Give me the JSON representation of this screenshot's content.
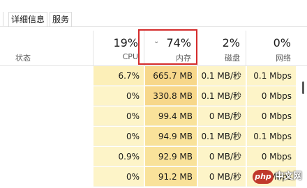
{
  "tabs": [
    "详细信息",
    "服务"
  ],
  "header": {
    "status": "状态",
    "cpu": {
      "pct": "19%",
      "name": "CPU"
    },
    "memory": {
      "pct": "74%",
      "name": "内存",
      "sort_indicator": "chevron-down-icon"
    },
    "disk": {
      "pct": "2%",
      "name": "磁盘"
    },
    "network": {
      "pct": "0%",
      "name": "网络"
    }
  },
  "rows": [
    {
      "cpu": "6.7%",
      "memory": "665.7 MB",
      "disk": "0.1 MB/秒",
      "network": "0.1 Mbps"
    },
    {
      "cpu": "0%",
      "memory": "330.8 MB",
      "disk": "0.1 MB/秒",
      "network": "0 Mbps"
    },
    {
      "cpu": "0%",
      "memory": "99.4 MB",
      "disk": "0 MB/秒",
      "network": "0 Mbps"
    },
    {
      "cpu": "0%",
      "memory": "94.9 MB",
      "disk": "0.1 MB/秒",
      "network": "0.1 Mbps"
    },
    {
      "cpu": "0.9%",
      "memory": "92.9 MB",
      "disk": "0 MB/秒",
      "network": "0 Mbps"
    },
    {
      "cpu": "0%",
      "memory": "91.2 MB",
      "disk": "0 MB/秒",
      "network": "0 Mbps"
    }
  ],
  "watermark": {
    "logo": "php",
    "text": "中文网"
  },
  "colors": {
    "highlight_border": "#d42b2b",
    "memory_fill": "#f9e29a",
    "cell_fill": "#fdf4c8"
  }
}
